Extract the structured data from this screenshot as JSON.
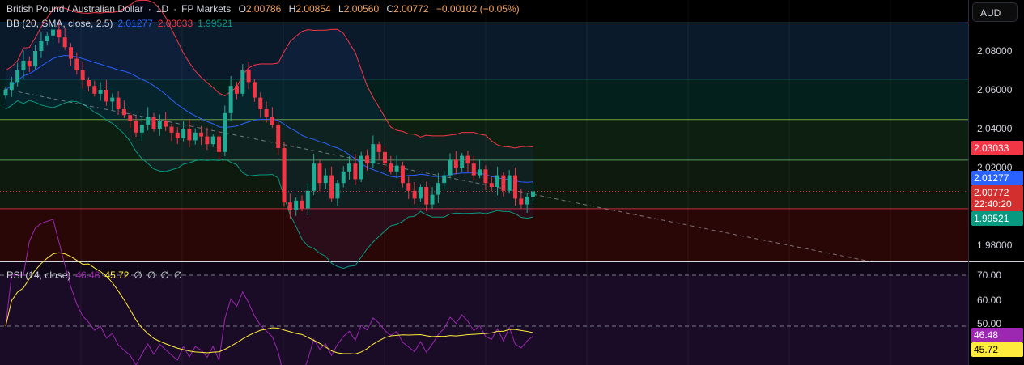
{
  "header": {
    "symbol": "British Pound / Australian Dollar",
    "interval": "1D",
    "exchange": "FP Markets",
    "sep": "·",
    "o_label": "O",
    "o": "2.00786",
    "h_label": "H",
    "h": "2.00854",
    "l_label": "L",
    "l": "2.00560",
    "c_label": "C",
    "c": "2.00772",
    "change": "−0.00102 (−0.05%)"
  },
  "bb": {
    "label": "BB (20, SMA, close, 2.5)",
    "basis": "2.01277",
    "upper": "2.03033",
    "lower": "1.99521"
  },
  "rsi": {
    "label": "RSI (14, close)",
    "value": "46.48",
    "ma": "45.72",
    "extras": [
      "∅",
      "∅",
      "∅",
      "∅"
    ]
  },
  "axis": {
    "currency": "AUD",
    "price_ticks": [
      "2.08000",
      "2.06000",
      "2.04000",
      "2.02000",
      "1.98000"
    ],
    "rsi_ticks": [
      "70.00",
      "60.00",
      "50.00"
    ],
    "last_price": "2.00772",
    "countdown": "22:40:20"
  },
  "colors": {
    "up": "#22ab94",
    "down": "#f23645",
    "basis": "#2962ff",
    "upper": "#f23645",
    "lower": "#089981",
    "rsi": "#9c27b0",
    "rsi_ma": "#ffeb3b"
  },
  "chart_data": {
    "type": "candlestick",
    "price_range": [
      1.974,
      2.098
    ],
    "rsi_range": [
      25,
      75
    ],
    "closes": [
      2.06,
      2.064,
      2.07,
      2.075,
      2.072,
      2.08,
      2.085,
      2.088,
      2.091,
      2.087,
      2.082,
      2.076,
      2.07,
      2.065,
      2.062,
      2.058,
      2.06,
      2.054,
      2.056,
      2.05,
      2.047,
      2.044,
      2.038,
      2.042,
      2.046,
      2.04,
      2.044,
      2.041,
      2.038,
      2.035,
      2.04,
      2.034,
      2.038,
      2.036,
      2.032,
      2.036,
      2.028,
      2.048,
      2.062,
      2.058,
      2.07,
      2.064,
      2.056,
      2.05,
      2.046,
      2.042,
      2.03,
      2.002,
      1.998,
      2.003,
      1.999,
      2.008,
      2.022,
      2.012,
      2.016,
      2.004,
      2.012,
      2.018,
      2.022,
      2.014,
      2.026,
      2.022,
      2.032,
      2.028,
      2.022,
      2.018,
      2.021,
      2.012,
      2.008,
      2.004,
      2.01,
      2.001,
      2.006,
      2.012,
      2.016,
      2.024,
      2.02,
      2.026,
      2.022,
      2.016,
      2.019,
      2.012,
      2.01,
      2.016,
      2.008,
      2.016,
      2.004,
      2.001,
      2.005,
      2.0077
    ],
    "fib_levels": [
      2.0945,
      2.0655,
      2.0447,
      2.0238,
      1.9988
    ]
  }
}
